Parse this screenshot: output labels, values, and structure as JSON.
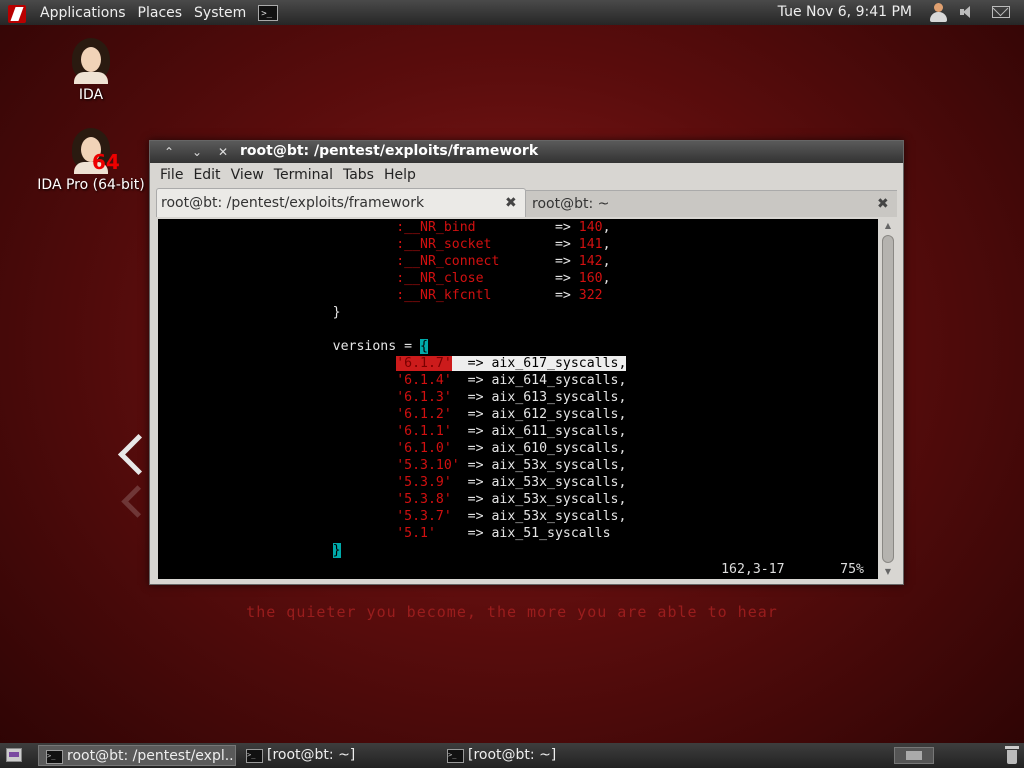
{
  "top_panel": {
    "menus": [
      "Applications",
      "Places",
      "System"
    ],
    "clock": "Tue Nov  6,  9:41 PM"
  },
  "desktop": {
    "icons": [
      {
        "label": "IDA"
      },
      {
        "label": "IDA Pro (64-bit)",
        "badge": "64"
      }
    ],
    "tagline": "the quieter you become, the more you are able to hear"
  },
  "window": {
    "title": "root@bt: /pentest/exploits/framework",
    "menu": [
      "File",
      "Edit",
      "View",
      "Terminal",
      "Tabs",
      "Help"
    ],
    "tabs": [
      {
        "label": "root@bt: /pentest/exploits/framework",
        "active": true
      },
      {
        "label": "root@bt: ~",
        "active": false
      }
    ],
    "terminal": {
      "syscall_entries": [
        {
          "name": ":__NR_bind",
          "value": "140"
        },
        {
          "name": ":__NR_socket",
          "value": "141"
        },
        {
          "name": ":__NR_connect",
          "value": "142"
        },
        {
          "name": ":__NR_close",
          "value": "160"
        },
        {
          "name": ":__NR_kfcntl",
          "value": "322"
        }
      ],
      "closing_brace": "}",
      "versions_decl": "versions = ",
      "open_brace": "{",
      "versions": [
        {
          "key": "'6.1.7'",
          "value": "aix_617_syscalls,"
        },
        {
          "key": "'6.1.4'",
          "value": "aix_614_syscalls,"
        },
        {
          "key": "'6.1.3'",
          "value": "aix_613_syscalls,"
        },
        {
          "key": "'6.1.2'",
          "value": "aix_612_syscalls,"
        },
        {
          "key": "'6.1.1'",
          "value": "aix_611_syscalls,"
        },
        {
          "key": "'6.1.0'",
          "value": "aix_610_syscalls,"
        },
        {
          "key": "'5.3.10'",
          "value": "aix_53x_syscalls,"
        },
        {
          "key": "'5.3.9'",
          "value": "aix_53x_syscalls,"
        },
        {
          "key": "'5.3.8'",
          "value": "aix_53x_syscalls,"
        },
        {
          "key": "'5.3.7'",
          "value": "aix_53x_syscalls,"
        },
        {
          "key": "'5.1'",
          "value": "aix_51_syscalls"
        }
      ],
      "final_brace": "}",
      "cursor_position": "162,3-17",
      "scroll_percent": "75%"
    }
  },
  "taskbar": {
    "tasks": [
      {
        "label": "root@bt: /pentest/expl...",
        "active": true
      },
      {
        "label": "[root@bt: ~]",
        "active": false
      },
      {
        "label": "[root@bt: ~]",
        "active": false
      }
    ]
  }
}
